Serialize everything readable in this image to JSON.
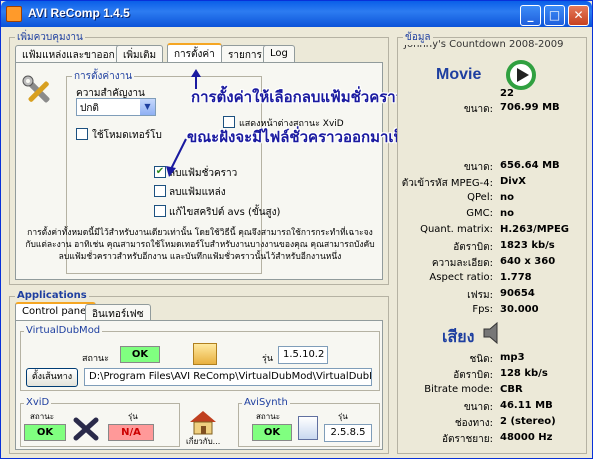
{
  "window": {
    "title": "AVI ReComp  1.4.5",
    "minimize": "_",
    "maximize": "□",
    "close": "✕"
  },
  "queue_group": {
    "title": "เพิ่มควบคุมงาน"
  },
  "tabs": [
    {
      "label": "แฟ้มแหล่งและขาออก"
    },
    {
      "label": "เพิ่มเติม"
    },
    {
      "label": "การตั้งค่า"
    },
    {
      "label": "รายการ"
    },
    {
      "label": "Log"
    }
  ],
  "settings": {
    "group_title": "การตั้งค่างาน",
    "priority_label": "ความสำคัญงาน",
    "priority_value": "ปกติ",
    "turbo_label": "ใช้โหมดเทอร์โบ",
    "options": [
      {
        "label": "แสดงหน้าต่างสถานะ XviD",
        "checked": false
      },
      {
        "label": "ลบแฟ้มชั่วคราว",
        "checked": true
      },
      {
        "label": "ลบแฟ้มแหล่ง",
        "checked": false
      },
      {
        "label": "แก้ไขสคริปต์ avs (ขั้นสูง)",
        "checked": false
      }
    ],
    "description": "การตั้งค่าทั้งหมดนี้มีไว้สำหรับงานเดียวเท่านั้น โดยใช้วิธีนี้ คุณจึงสามารถใช้การกระทำที่เฉาะจงกับแต่ละงาน อาทิเช่น คุณสามารถใช้โหมดเทอร์โบสำหรับงานบางงานของคุณ คุณสามารถบังคับลบแฟ้มชั่วคราวสำหรับอีกงาน และบันทึกแฟ้มชั่วคราวนั้นไว้สำหรับอีกงานหนึ่ง"
  },
  "annotations": {
    "line1": "การตั้งค่าให้เลือกลบแฟ้มชั่วคราวด้วยค่ะ",
    "line2": "ขณะฝังจะมีไฟล์ชั่วคราวออกมาเป็นก๊กเลยค่ะ"
  },
  "applications": {
    "title": "Applications",
    "tabs": [
      {
        "label": "Control panel"
      },
      {
        "label": "อินเทอร์เฟซ"
      }
    ],
    "vdm": {
      "title": "VirtualDubMod",
      "status_label": "สถานะ",
      "status_value": "OK",
      "version_label": "รุ่น",
      "version_value": "1.5.10.2",
      "set_path_button": "ตั้งเส้นทาง",
      "path": "D:\\Program Files\\AVI ReComp\\VirtualDubMod\\VirtualDubMod.exe"
    },
    "xvid": {
      "title": "XviD",
      "status_label": "สถานะ",
      "status_value": "OK",
      "version_label": "รุ่น",
      "version_value": "N/A"
    },
    "home": {
      "label": "เกี่ยวกับ..."
    },
    "avisynth": {
      "title": "AviSynth",
      "status_label": "สถานะ",
      "status_value": "OK",
      "version_label": "รุ่น",
      "version_value": "2.5.8.5"
    }
  },
  "info": {
    "title": "ข้อมูล",
    "subtitle": "Johnny's Countdown 2008-2009",
    "movie_heading": "Movie",
    "movie_partial": [
      {
        "key": "",
        "value": "22"
      },
      {
        "key": "ขนาด:",
        "value": "706.99 MB"
      }
    ],
    "movie_rows": [
      {
        "key": "ขนาด:",
        "value": "656.64 MB"
      },
      {
        "key": "ตัวเข้ารหัส MPEG-4:",
        "value": "DivX"
      },
      {
        "key": "QPel:",
        "value": "no"
      },
      {
        "key": "GMC:",
        "value": "no"
      },
      {
        "key": "Quant. matrix:",
        "value": "H.263/MPEG"
      },
      {
        "key": "อัตราบิต:",
        "value": "1823 kb/s"
      },
      {
        "key": "ความละเอียด:",
        "value": "640 x 360"
      },
      {
        "key": "Aspect ratio:",
        "value": "1.778"
      },
      {
        "key": "เฟรม:",
        "value": "90654"
      },
      {
        "key": "Fps:",
        "value": "30.000"
      }
    ],
    "sound_heading": "เสียง",
    "sound_rows": [
      {
        "key": "ชนิด:",
        "value": "mp3"
      },
      {
        "key": "อัตราบิต:",
        "value": "128 kb/s"
      },
      {
        "key": "Bitrate mode:",
        "value": "CBR"
      },
      {
        "key": "ขนาด:",
        "value": "46.11 MB"
      },
      {
        "key": "ช่องทาง:",
        "value": "2 (stereo)"
      },
      {
        "key": "อัตราชยาย:",
        "value": "48000 Hz"
      }
    ]
  },
  "colors": {
    "title_bar": "#0b53d8",
    "ok_green": "#80ff80",
    "na_red": "#ff9999",
    "annotation": "#1a1aa0"
  }
}
